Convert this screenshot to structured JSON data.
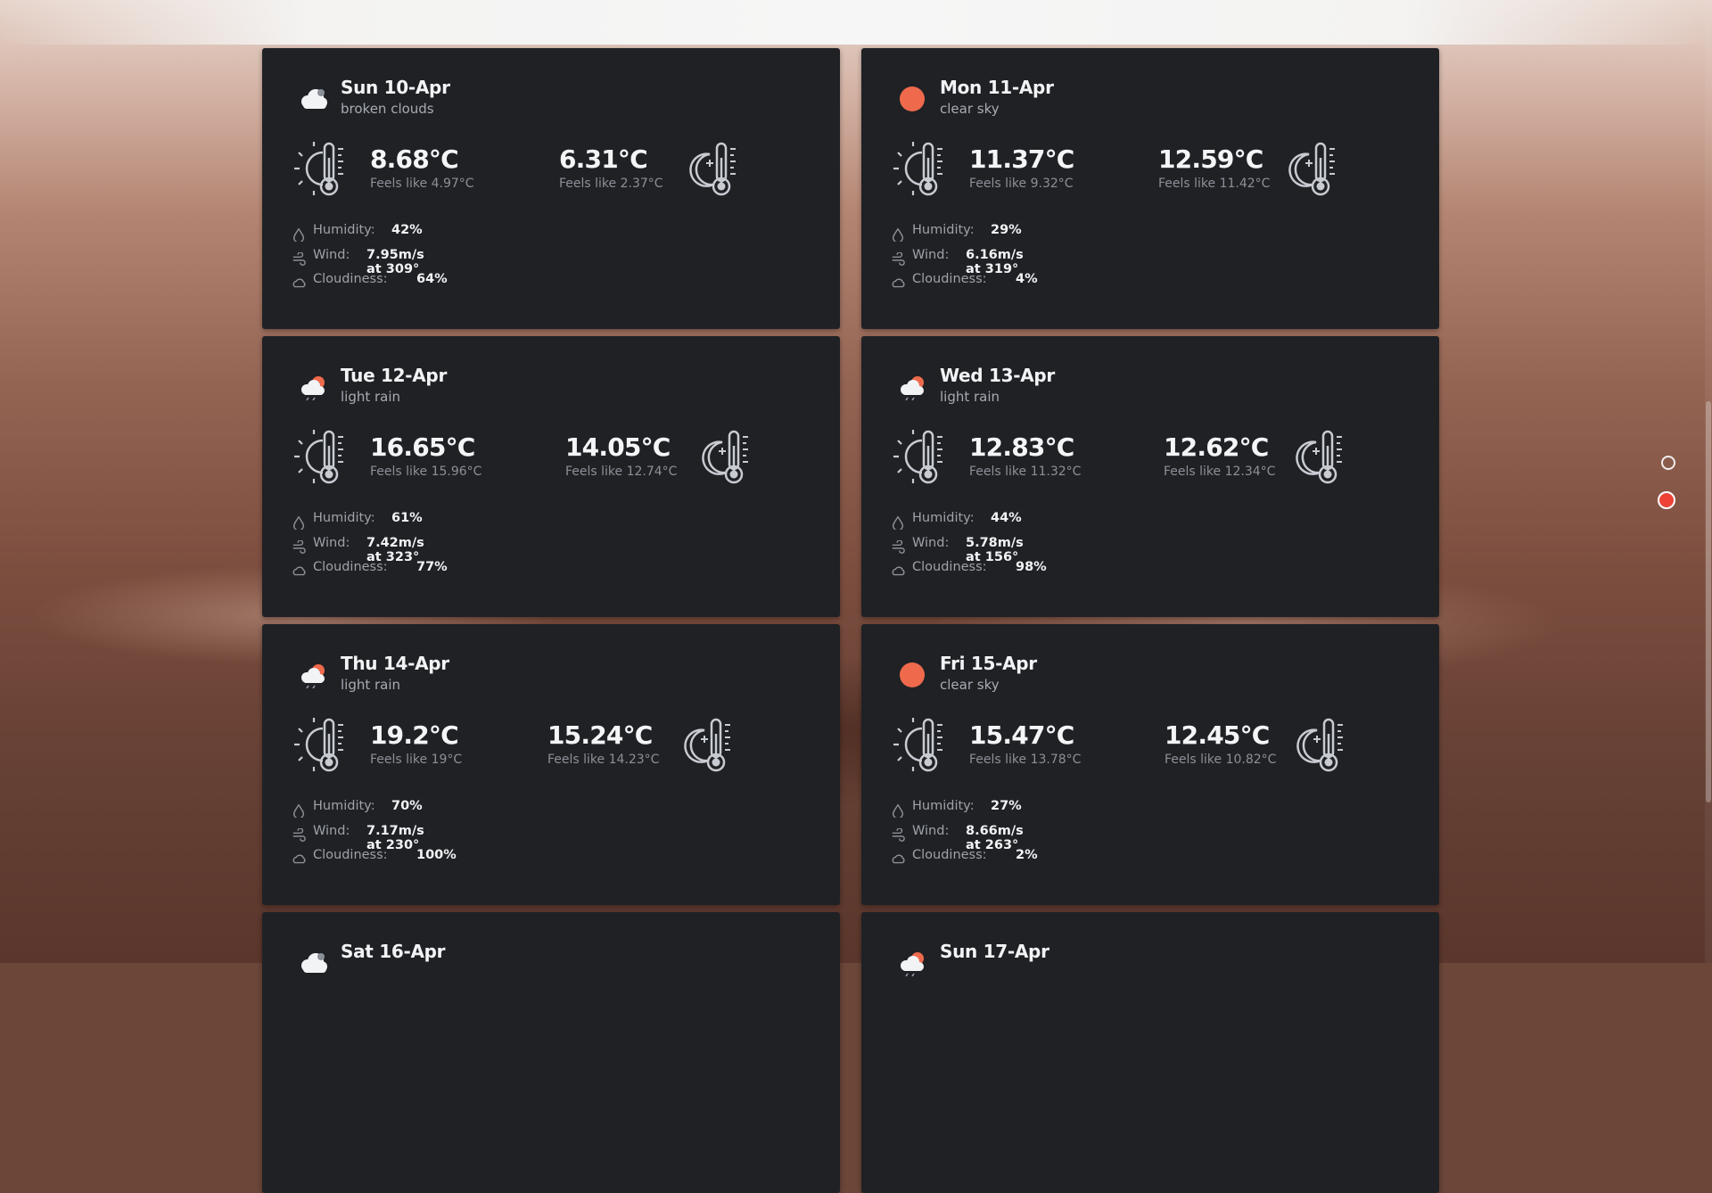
{
  "forecast": [
    {
      "day": "Sun 10-Apr",
      "desc": "broken clouds",
      "icon": "cloud-icon",
      "day_temp": "8.68°C",
      "day_feels": "Feels like 4.97°C",
      "night_temp": "6.31°C",
      "night_feels": "Feels like 2.37°C",
      "humidity_label": "Humidity:",
      "humidity": "42%",
      "wind_label": "Wind:",
      "wind": "7.95m/s at 309°",
      "cloud_label": "Cloudiness:",
      "cloudiness": "64%"
    },
    {
      "day": "Mon 11-Apr",
      "desc": "clear sky",
      "icon": "sun-icon",
      "day_temp": "11.37°C",
      "day_feels": "Feels like 9.32°C",
      "night_temp": "12.59°C",
      "night_feels": "Feels like 11.42°C",
      "humidity_label": "Humidity:",
      "humidity": "29%",
      "wind_label": "Wind:",
      "wind": "6.16m/s at 319°",
      "cloud_label": "Cloudiness:",
      "cloudiness": "4%"
    },
    {
      "day": "Tue 12-Apr",
      "desc": "light rain",
      "icon": "rain-icon",
      "day_temp": "16.65°C",
      "day_feels": "Feels like 15.96°C",
      "night_temp": "14.05°C",
      "night_feels": "Feels like 12.74°C",
      "humidity_label": "Humidity:",
      "humidity": "61%",
      "wind_label": "Wind:",
      "wind": "7.42m/s at 323°",
      "cloud_label": "Cloudiness:",
      "cloudiness": "77%"
    },
    {
      "day": "Wed 13-Apr",
      "desc": "light rain",
      "icon": "rain-icon",
      "day_temp": "12.83°C",
      "day_feels": "Feels like 11.32°C",
      "night_temp": "12.62°C",
      "night_feels": "Feels like 12.34°C",
      "humidity_label": "Humidity:",
      "humidity": "44%",
      "wind_label": "Wind:",
      "wind": "5.78m/s at 156°",
      "cloud_label": "Cloudiness:",
      "cloudiness": "98%"
    },
    {
      "day": "Thu 14-Apr",
      "desc": "light rain",
      "icon": "rain-icon",
      "day_temp": "19.2°C",
      "day_feels": "Feels like 19°C",
      "night_temp": "15.24°C",
      "night_feels": "Feels like 14.23°C",
      "humidity_label": "Humidity:",
      "humidity": "70%",
      "wind_label": "Wind:",
      "wind": "7.17m/s at 230°",
      "cloud_label": "Cloudiness:",
      "cloudiness": "100%"
    },
    {
      "day": "Fri 15-Apr",
      "desc": "clear sky",
      "icon": "sun-icon",
      "day_temp": "15.47°C",
      "day_feels": "Feels like 13.78°C",
      "night_temp": "12.45°C",
      "night_feels": "Feels like 10.82°C",
      "humidity_label": "Humidity:",
      "humidity": "27%",
      "wind_label": "Wind:",
      "wind": "8.66m/s at 263°",
      "cloud_label": "Cloudiness:",
      "cloudiness": "2%"
    },
    {
      "day": "Sat 16-Apr",
      "icon": "cloud-icon"
    },
    {
      "day": "Sun 17-Apr",
      "icon": "rain-icon"
    }
  ],
  "colors": {
    "card": "#1f2125",
    "accent": "#ef6a4c",
    "muted": "#8c9097"
  },
  "pager": {
    "active_index": 1
  }
}
